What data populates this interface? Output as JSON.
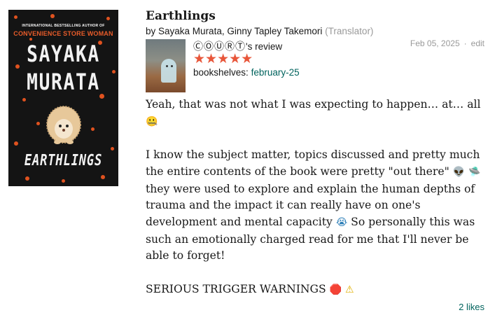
{
  "cover": {
    "tagline": "INTERNATIONAL BESTSELLING AUTHOR OF",
    "previous_title": "CONVENIENCE STORE WOMAN",
    "author_line1": "SAYAKA",
    "author_line2": "MURATA",
    "title": "EARTHLINGS"
  },
  "book": {
    "title": "Earthlings",
    "by_prefix": "by",
    "authors": "Sayaka Murata, Ginny Tapley Takemori",
    "translator_role": "(Translator)"
  },
  "review_meta": {
    "date": "Feb 05, 2025",
    "separator": "·",
    "edit_label": "edit"
  },
  "reviewer": {
    "name": "ⒸⓄⓊⓇⓉ",
    "suffix": "'s review",
    "rating": 5,
    "stars": "★★★★★",
    "shelves_label": "bookshelves:",
    "shelf": "february-25"
  },
  "review": {
    "p1_text": "Yeah, that was not what I was expecting to happen… at… all",
    "p1_emoji": "🤐",
    "p2_part1": "I know the subject matter, topics discussed and pretty much the entire contents of the book were pretty \"out there\"",
    "p2_emoji_alien": "👽",
    "p2_emoji_ufo": "🛸",
    "p2_part2": "they were used to explore and explain the human depths of trauma and the impact it can really have on one's development and mental capacity",
    "p2_emoji_cry": "😭",
    "p2_part3": "So personally this was such an emotionally charged read for me that I'll never be able to forget!",
    "p3_text": "SERIOUS TRIGGER WARNINGS",
    "p3_emoji_stop": "🛑",
    "p3_emoji_warning": "⚠"
  },
  "footer": {
    "likes": "2 likes"
  },
  "colors": {
    "link": "#00635d",
    "star": "#e8563a",
    "muted": "#999999",
    "cover_accent": "#e95c2a"
  }
}
